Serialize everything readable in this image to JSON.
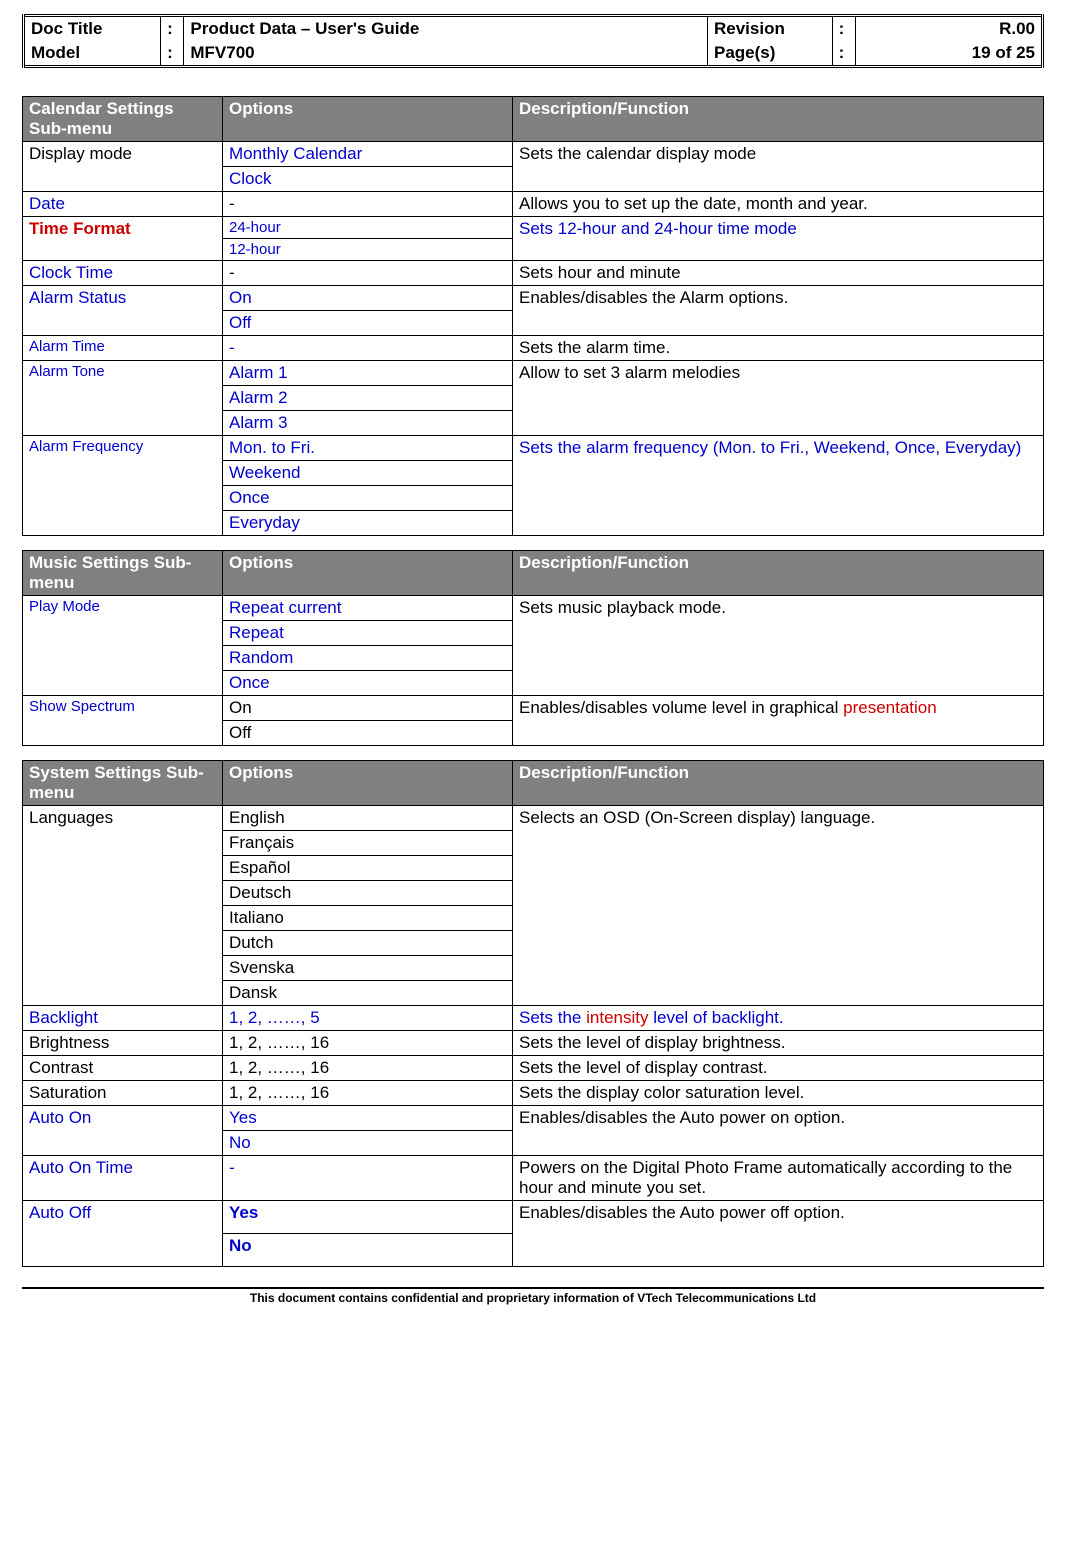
{
  "header": {
    "doc_title_label": "Doc Title",
    "doc_title": "Product Data – User's Guide",
    "model_label": "Model",
    "model": "MFV700",
    "revision_label": "Revision",
    "revision": "R.00",
    "pages_label": "Page(s)",
    "pages": "19 of 25",
    "colon": ":"
  },
  "tables": {
    "calendar": {
      "h1": "Calendar Settings Sub-menu",
      "h2": "Options",
      "h3": "Description/Function",
      "rows": {
        "display_mode": {
          "label": "Display mode",
          "o1": "Monthly Calendar",
          "o2": "Clock",
          "desc": "Sets the calendar display mode"
        },
        "date": {
          "label": "Date",
          "opt": "-",
          "desc": "Allows you to set up the date, month and year."
        },
        "time_format": {
          "label": "Time Format",
          "o1": "24-hour",
          "o2": "12-hour",
          "desc": "Sets 12-hour and 24-hour time mode"
        },
        "clock_time": {
          "label": "Clock Time",
          "opt": "-",
          "desc": "Sets hour and minute"
        },
        "alarm_status": {
          "label": "Alarm Status",
          "o1": "On",
          "o2": "Off",
          "desc": "Enables/disables the Alarm options."
        },
        "alarm_time": {
          "label": "Alarm Time",
          "opt": "-",
          "desc": "Sets the alarm time."
        },
        "alarm_tone": {
          "label": "Alarm Tone",
          "o1": "Alarm 1",
          "o2": "Alarm 2",
          "o3": "Alarm 3",
          "desc": "Allow to set 3 alarm melodies"
        },
        "alarm_freq": {
          "label": "Alarm Frequency",
          "o1": "Mon. to Fri.",
          "o2": "Weekend",
          "o3": "Once",
          "o4": "Everyday",
          "desc": "Sets the alarm frequency (Mon. to Fri., Weekend, Once, Everyday)"
        }
      }
    },
    "music": {
      "h1": "Music Settings Sub-menu",
      "h2": "Options",
      "h3": "Description/Function",
      "rows": {
        "play_mode": {
          "label": "Play Mode",
          "o1": "Repeat current",
          "o2": "Repeat",
          "o3": "Random",
          "o4": "Once",
          "desc": "Sets music playback mode."
        },
        "show_spectrum": {
          "label": "Show Spectrum",
          "o1": "On",
          "o2": "Off",
          "desc_a": "Enables/disables volume level in graphical ",
          "desc_b": "presentation"
        }
      }
    },
    "system": {
      "h1": "System Settings Sub-menu",
      "h2": "Options",
      "h3": "Description/Function",
      "rows": {
        "languages": {
          "label": "Languages",
          "o1": "English",
          "o2": "Français",
          "o3": "Español",
          "o4": "Deutsch",
          "o5": "Italiano",
          "o6": "Dutch",
          "o7": "Svenska",
          "o8": "Dansk",
          "desc": "Selects an OSD (On-Screen display) language."
        },
        "backlight": {
          "label": "Backlight",
          "opt": "1, 2, ……, 5",
          "desc_a": "Sets the ",
          "desc_b": "intensity",
          "desc_c": " level of backlight."
        },
        "brightness": {
          "label": "Brightness",
          "opt": "1, 2, ……, 16",
          "desc": "Sets the level of display brightness."
        },
        "contrast": {
          "label": "Contrast",
          "opt": "1, 2, ……, 16",
          "desc": "Sets the level of display contrast."
        },
        "saturation": {
          "label": "Saturation",
          "opt": "1, 2, ……, 16",
          "desc": "Sets the display color saturation level."
        },
        "auto_on": {
          "label": "Auto On",
          "o1": "Yes",
          "o2": "No",
          "desc": "Enables/disables the Auto power on option."
        },
        "auto_on_time": {
          "label": "Auto On Time",
          "opt": "-",
          "desc": "Powers on the Digital Photo Frame automatically according to the hour and minute you set."
        },
        "auto_off": {
          "label": "Auto Off",
          "o1": "Yes",
          "o2": "No",
          "desc": "Enables/disables the Auto power off option."
        }
      }
    }
  },
  "footer": "This document contains confidential and proprietary information of VTech Telecommunications Ltd"
}
